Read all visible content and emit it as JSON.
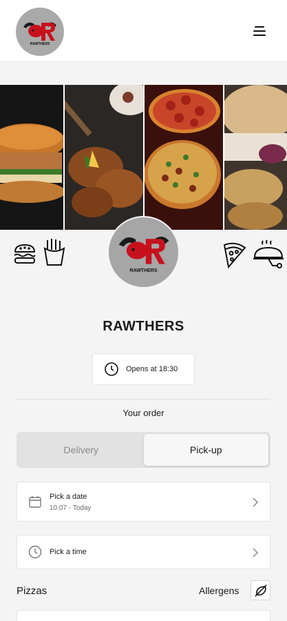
{
  "header": {
    "logo_text": "RAWTHERS",
    "menu_icon": "hamburger-menu-icon"
  },
  "banner": {
    "panels": [
      "burger-photo",
      "grilled-chicken-photo",
      "pizza-photo",
      "sandwich-photo"
    ]
  },
  "category_icons": {
    "left": [
      "burger-icon",
      "fries-icon"
    ],
    "right": [
      "pizza-slice-icon",
      "dish-icon"
    ]
  },
  "restaurant": {
    "logo_text": "RAWTHERS",
    "name": "RAWTHERS",
    "opens_label": "Opens at 18:30"
  },
  "order": {
    "heading": "Your order",
    "modes": [
      "Delivery",
      "Pick-up"
    ],
    "active_mode": "Pick-up",
    "date": {
      "label": "Pick a date",
      "value": "10.07 - Today"
    },
    "time": {
      "label": "Pick a time"
    }
  },
  "menu_section": {
    "title": "Pizzas",
    "allergens_label": "Allergens"
  },
  "colors": {
    "background": "#f4f4f4",
    "logo_bg": "#a6a6a6",
    "logo_red": "#c8101d"
  }
}
